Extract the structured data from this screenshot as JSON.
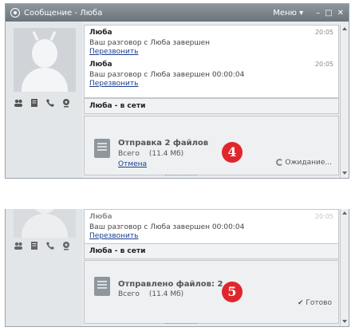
{
  "window": {
    "title": "Сообщение - Люба",
    "menu_label": "Меню",
    "menu_arrow": "▾",
    "minimize": "–",
    "maximize": "□",
    "close": "✕"
  },
  "panel1": {
    "messages": [
      {
        "author": "Люба",
        "time": "20:05"
      },
      {
        "text": "Ваш разговор с Люба завершен",
        "link": "Перезвонить"
      },
      {
        "author": "Люба",
        "time": "20:05"
      },
      {
        "text": "Ваш разговор с Люба завершен 00:00:04",
        "link": "Перезвонить"
      }
    ],
    "status_text": "Люба - в сети",
    "transfer": {
      "title": "Отправка 2 файлов",
      "size_label": "Всего",
      "size_value": "(11.4 Мб)",
      "cancel": "Отмена",
      "state": "Ожидание..."
    },
    "badge": "4"
  },
  "panel2": {
    "messages": [
      {
        "author": "Люба",
        "time": "20:05"
      },
      {
        "text": "Ваш разговор с Люба завершен 00:00:04",
        "link": "Перезвонить"
      }
    ],
    "status_text": "Люба - в сети",
    "transfer": {
      "title": "Отправлено файлов: 2",
      "size_label": "Всего",
      "size_value": "(11.4 Мб)",
      "state": "✔ Готово"
    },
    "badge": "5"
  }
}
